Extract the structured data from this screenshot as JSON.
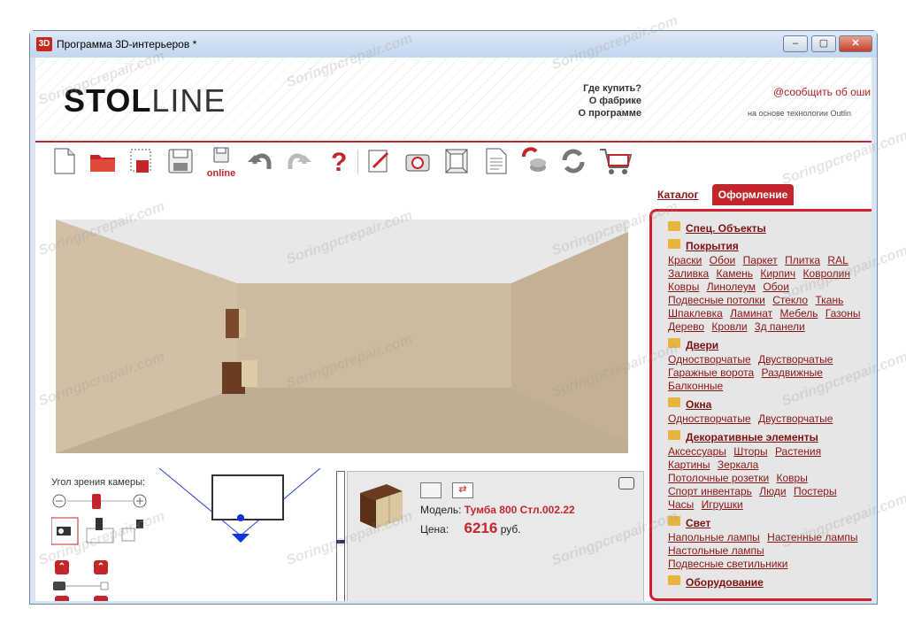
{
  "window": {
    "title": "Программа 3D-интерьеров *",
    "icon_text": "3D"
  },
  "header": {
    "links": [
      "Где купить?",
      "О фабрике",
      "О программе"
    ],
    "notify": "@сообщить об оши",
    "tech": "на основе технологии Outlin",
    "logo_a": "STOL",
    "logo_b": "LINE"
  },
  "toolbar": {
    "online_label": "online"
  },
  "tabs": {
    "catalog": "Каталог",
    "design": "Оформление"
  },
  "camera": {
    "label": "Угол зрения камеры:"
  },
  "product": {
    "model_label": "Модель:",
    "model": "Тумба 800 Стл.002.22",
    "price_label": "Цена:",
    "price": "6216",
    "currency": "руб."
  },
  "categories": [
    {
      "title": "Спец. Объекты",
      "items": []
    },
    {
      "title": "Покрытия",
      "items": [
        "Краски",
        "Обои",
        "Паркет",
        "Плитка",
        "RAL",
        "Заливка",
        "Камень",
        "Кирпич",
        "Ковролин",
        "Ковры",
        "Линолеум",
        "Обои",
        "Подвесные потолки",
        "Стекло",
        "Ткань",
        "Шпаклевка",
        "Ламинат",
        "Мебель",
        "Газоны",
        "Дерево",
        "Кровли",
        "3д панели"
      ]
    },
    {
      "title": "Двери",
      "items": [
        "Одностворчатые",
        "Двустворчатые",
        "Гаражные ворота",
        "Раздвижные",
        "Балконные"
      ]
    },
    {
      "title": "Окна",
      "items": [
        "Одностворчатые",
        "Двустворчатые"
      ]
    },
    {
      "title": "Декоративные элементы",
      "items": [
        "Аксессуары",
        "Шторы",
        "Растения",
        "Картины",
        "Зеркала",
        "Потолочные розетки",
        "Ковры",
        "Спорт инвентарь",
        "Люди",
        "Постеры",
        "Часы",
        "Игрушки"
      ]
    },
    {
      "title": "Свет",
      "items": [
        "Напольные лампы",
        "Настенные лампы",
        "Настольные лампы",
        "Подвесные светильники"
      ]
    },
    {
      "title": "Оборудование",
      "items": []
    }
  ],
  "watermark": "Soringpcrepair.com",
  "colors": {
    "accent": "#c3262a",
    "link": "#8b1515"
  }
}
